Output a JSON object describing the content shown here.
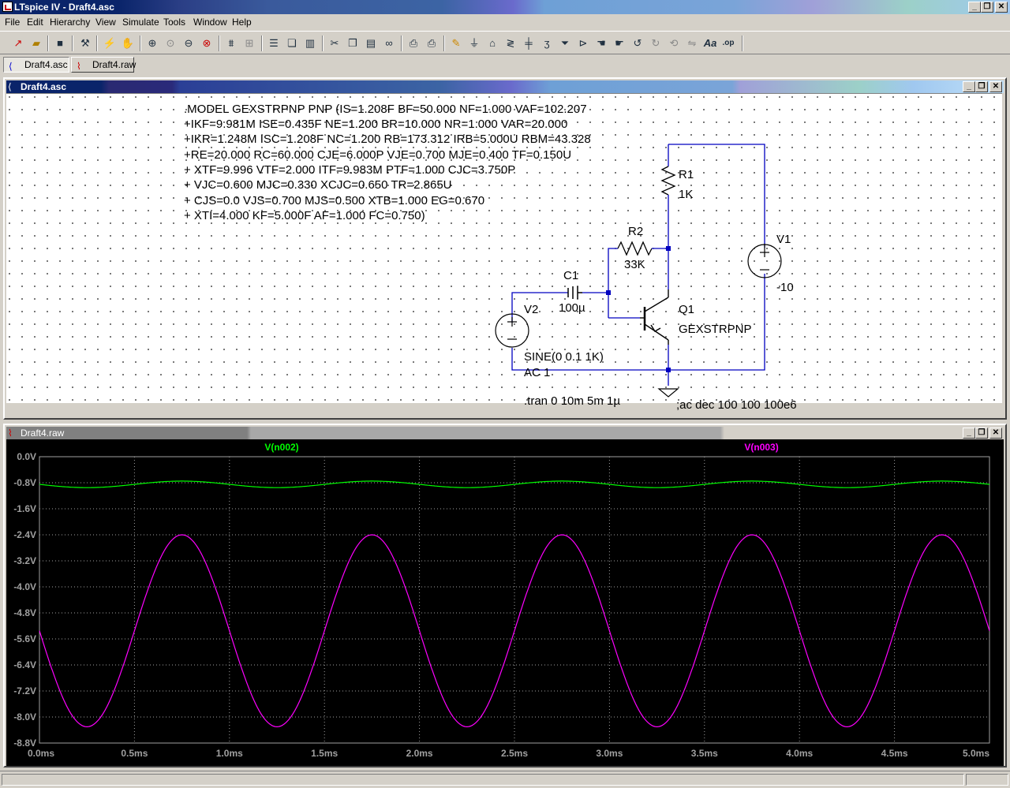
{
  "app": {
    "title": "LTspice IV - Draft4.asc"
  },
  "menu": {
    "items": [
      "File",
      "Edit",
      "Hierarchy",
      "View",
      "Simulate",
      "Tools",
      "Window",
      "Help"
    ]
  },
  "toolbar": {
    "buttons": [
      "new-schematic",
      "open",
      "save",
      "control-panel",
      "run",
      "halt",
      "zoom-in",
      "pan",
      "zoom-out",
      "zoom-fit",
      "autorange",
      "cancel-zoom",
      "tile-horizontal",
      "cascade",
      "tile-vertical",
      "cut",
      "copy",
      "paste",
      "find",
      "print-setup",
      "print",
      "draw-wire",
      "ground",
      "label-net",
      "resistor",
      "capacitor",
      "inductor",
      "diode",
      "component",
      "move",
      "drag",
      "undo",
      "redo",
      "rotate",
      "mirror",
      "text",
      "spice-directive"
    ]
  },
  "tabs": [
    {
      "label": "Draft4.asc",
      "icon": "schematic-icon",
      "active": true
    },
    {
      "label": "Draft4.raw",
      "icon": "waveform-icon",
      "active": false
    }
  ],
  "schematic_window": {
    "title": "Draft4.asc",
    "model_lines": [
      ".MODEL GEXSTRPNP PNP (IS=1.208F BF=50.000 NF=1.000 VAF=102.207",
      "+IKF=9.981M ISE=0.435F NE=1.200 BR=10.000 NR=1.000 VAR=20.000",
      "+IKR=1.248M ISC=1.208F NC=1.200 RB=173.312 IRB=5.000U RBM=43.328",
      "+RE=20.000 RC=60.000 CJE=6.000P VJE=0.700 MJE=0.400 TF=0.150U",
      "+ XTF=9.996 VTF=2.000 ITF=9.983M PTF=1.000 CJC=3.750P",
      "+ VJC=0.600 MJC=0.330 XCJC=0.650 TR=2.865U",
      "+ CJS=0.0 VJS=0.700 MJS=0.500 XTB=1.000 EG=0.670",
      "+ XTI=4.000 KF=5.000F AF=1.000 FC=0.750)"
    ],
    "components": {
      "r1": {
        "name": "R1",
        "value": "1K"
      },
      "r2": {
        "name": "R2",
        "value": "33K"
      },
      "c1": {
        "name": "C1",
        "value": "100µ"
      },
      "q1": {
        "name": "Q1",
        "value": "GEXSTRPNP"
      },
      "v1": {
        "name": "V1",
        "value": "-10"
      },
      "v2": {
        "name": "V2",
        "value": "SINE(0 0.1 1K)",
        "ac": "AC 1"
      }
    },
    "directives": {
      "tran": ".tran 0 10m 5m 1µ",
      "ac": ";ac dec 100 100 100e6"
    }
  },
  "plot_window": {
    "title": "Draft4.raw",
    "colors": {
      "background": "#000000",
      "grid": "#a0a0a0",
      "trace1": "#00ff00",
      "trace2": "#ff00ff"
    }
  },
  "chart_data": {
    "type": "line",
    "x_unit": "ms",
    "xlim": [
      0,
      5
    ],
    "ylim": [
      -8.8,
      0
    ],
    "x_ticks": [
      "0.0ms",
      "0.5ms",
      "1.0ms",
      "1.5ms",
      "2.0ms",
      "2.5ms",
      "3.0ms",
      "3.5ms",
      "4.0ms",
      "4.5ms",
      "5.0ms"
    ],
    "y_ticks": [
      "0.0V",
      "-0.8V",
      "-1.6V",
      "-2.4V",
      "-3.2V",
      "-4.0V",
      "-4.8V",
      "-5.6V",
      "-6.4V",
      "-7.2V",
      "-8.0V",
      "-8.8V"
    ],
    "grid": true,
    "series": [
      {
        "name": "V(n002)",
        "color": "#00ff00",
        "waveform": "sine",
        "frequency_khz": 1,
        "offset": -0.85,
        "amplitude": 0.1,
        "phase_deg": 180
      },
      {
        "name": "V(n003)",
        "color": "#ff00ff",
        "waveform": "sine",
        "frequency_khz": 1,
        "offset": -5.35,
        "amplitude": 2.95,
        "phase_deg": 180
      }
    ]
  }
}
